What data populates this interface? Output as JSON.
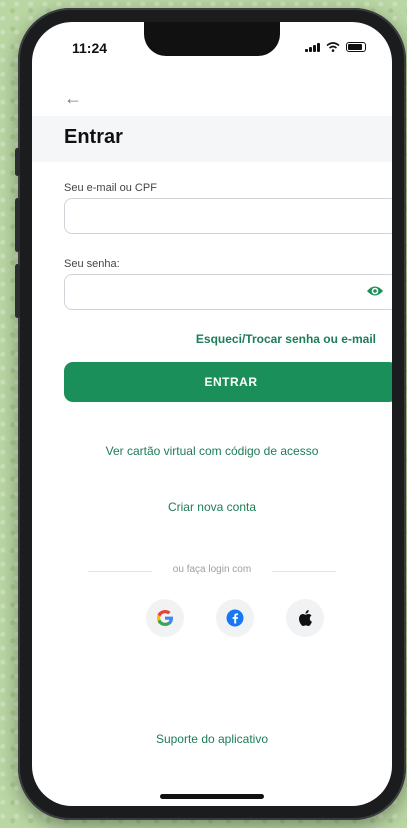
{
  "status_bar": {
    "time": "11:24"
  },
  "header": {
    "back_icon": "arrow-left-icon",
    "title": "Entrar"
  },
  "form": {
    "email_label": "Seu e-mail ou CPF",
    "email_value": "",
    "password_label": "Seu senha:",
    "password_value": "",
    "forgot_link": "Esqueci/Trocar senha ou e-mail",
    "submit_label": "ENTRAR"
  },
  "links": {
    "virtual_card": "Ver cartão virtual com código de acesso",
    "create_account": "Criar nova conta"
  },
  "social": {
    "divider_text": "ou faça login com",
    "providers": [
      "google-icon",
      "facebook-icon",
      "apple-icon"
    ]
  },
  "support": {
    "label": "Suporte do aplicativo"
  },
  "colors": {
    "primary": "#1b8f59",
    "link": "#1d7d57",
    "background": "#b9d6a3"
  }
}
